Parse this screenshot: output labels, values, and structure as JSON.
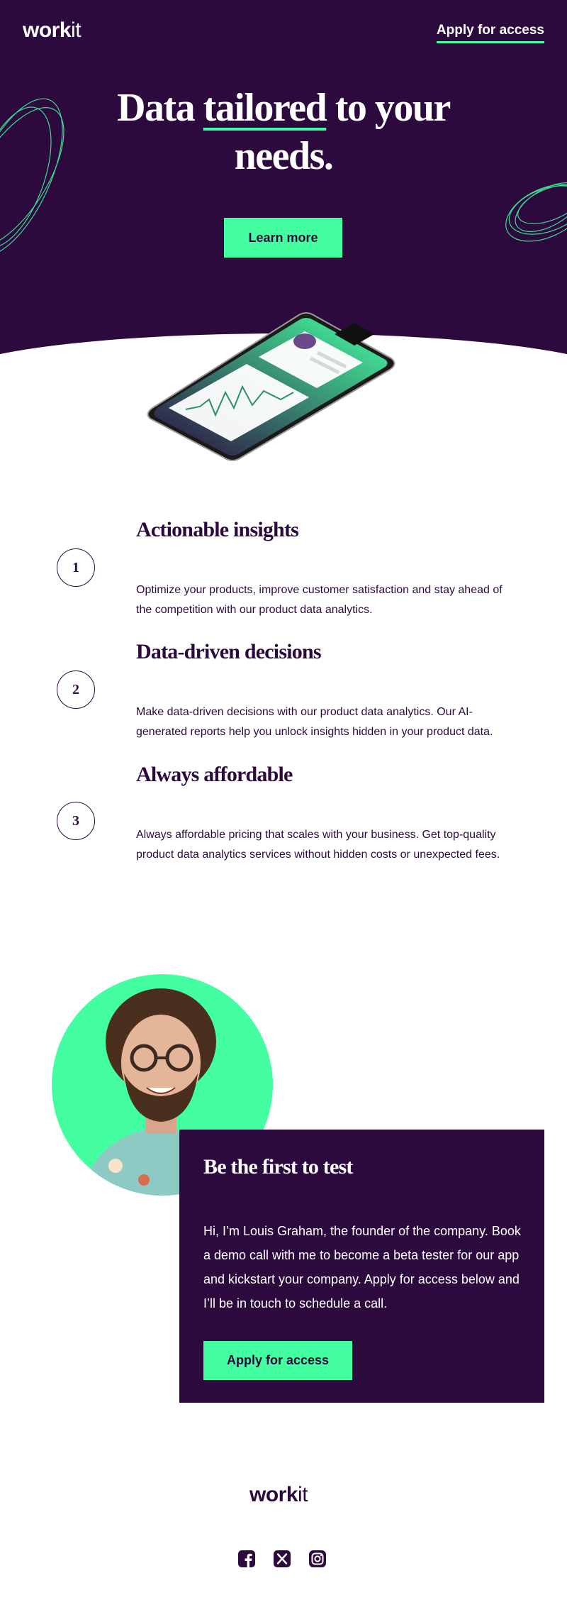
{
  "header": {
    "logo_bold": "work",
    "logo_light": "it",
    "nav_link": "Apply for access"
  },
  "hero": {
    "title_before": "Data ",
    "title_highlight": "tailored",
    "title_after": " to your needs.",
    "button": "Learn more"
  },
  "features": [
    {
      "number": "1",
      "title": "Actionable insights",
      "text": "Optimize your products, improve customer satisfaction and stay ahead of the competition with our product data analytics."
    },
    {
      "number": "2",
      "title": "Data-driven decisions",
      "text": "Make data-driven decisions with our product data analytics. Our AI-generated reports help you unlock insights hidden in your product data."
    },
    {
      "number": "3",
      "title": "Always affordable",
      "text": "Always affordable pricing that scales with your business. Get top-quality product data analytics services without hidden costs or unexpected fees."
    }
  ],
  "cta": {
    "title": "Be the first to test",
    "text": "Hi, I’m Louis Graham, the founder of the company. Book a demo call with me to become a beta tester for our app and kickstart your company. Apply for access below and I’ll be in touch to schedule a call.",
    "button": "Apply for access"
  },
  "footer": {
    "logo_bold": "work",
    "logo_light": "it",
    "socials": [
      "facebook-icon",
      "x-icon",
      "instagram-icon"
    ]
  },
  "colors": {
    "brand_dark": "#2c0a3e",
    "accent": "#44ffa1",
    "white": "#ffffff"
  }
}
